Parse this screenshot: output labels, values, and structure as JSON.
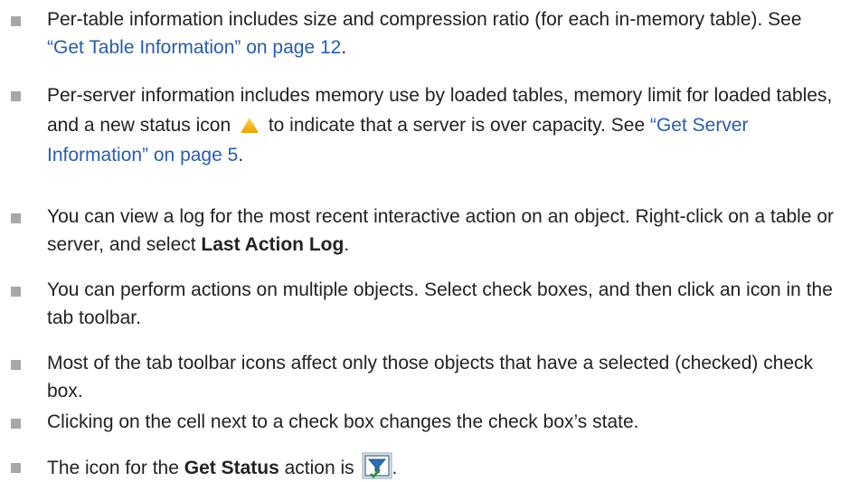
{
  "items": [
    {
      "text_before": "Per-table information includes size and compression ratio (for each in-memory table). See ",
      "link": "“Get Table Information” on page 12",
      "text_after": "."
    },
    {
      "text_before": "Per-server information includes memory use by loaded tables, memory limit for loaded tables, and a new status icon",
      "text_middle": "to indicate that a server is over capacity. See ",
      "link": "“Get Server Information” on page 5",
      "text_after": "."
    },
    {
      "text_before": "You can view a log for the most recent interactive action on an object. Right-click on a table or server, and select ",
      "bold": "Last Action Log",
      "text_after": "."
    },
    {
      "text": "You can perform actions on multiple objects. Select check boxes, and then click an icon in the tab toolbar."
    },
    {
      "text": "Most of the tab toolbar icons affect only those objects that have a selected (checked) check box."
    },
    {
      "text": "Clicking on the cell next to a check box changes the check box’s state."
    },
    {
      "text_before": "The icon for the ",
      "bold": "Get Status",
      "text_middle": " action is",
      "text_after": "."
    }
  ],
  "colors": {
    "text": "#222222",
    "link": "#2a5caa",
    "bullet": "#a7a7a7",
    "warning_icon": "#f2b600"
  },
  "icons": {
    "capacity_status": "warning-triangle-icon",
    "get_status": "get-status-icon"
  }
}
